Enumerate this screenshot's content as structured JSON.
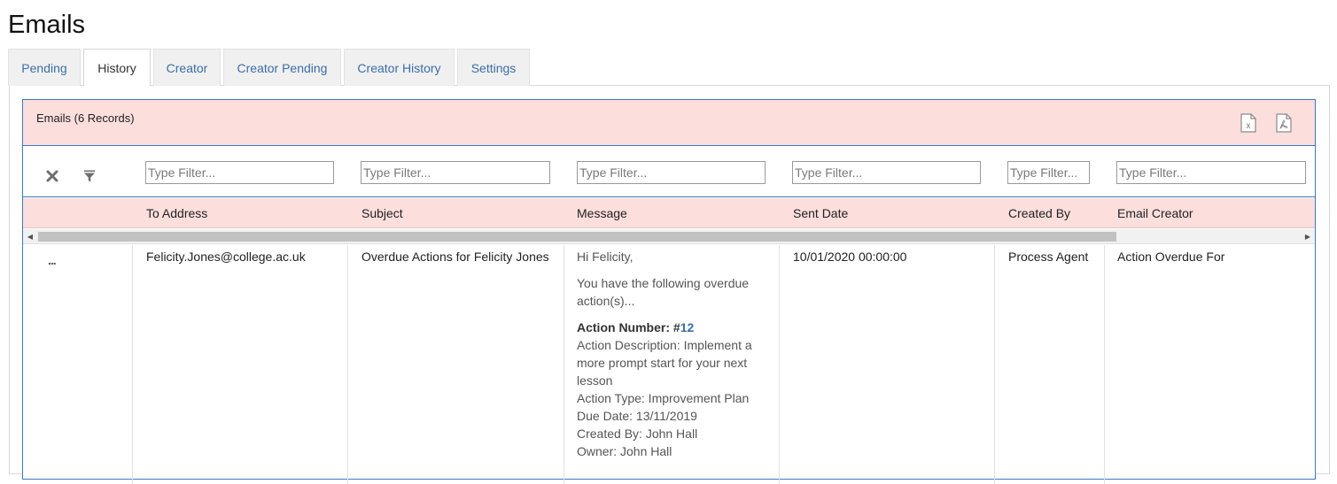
{
  "page": {
    "title": "Emails"
  },
  "tabs": [
    {
      "label": "Pending"
    },
    {
      "label": "History"
    },
    {
      "label": "Creator"
    },
    {
      "label": "Creator Pending"
    },
    {
      "label": "Creator History"
    },
    {
      "label": "Settings"
    }
  ],
  "active_tab": "History",
  "grid": {
    "title": "Emails (6 Records)",
    "export": {
      "excel_icon": "excel-export-icon",
      "pdf_icon": "pdf-export-icon"
    },
    "filter_placeholder": "Type Filter...",
    "columns": [
      {
        "label": "To Address"
      },
      {
        "label": "Subject"
      },
      {
        "label": "Message"
      },
      {
        "label": "Sent Date"
      },
      {
        "label": "Created By"
      },
      {
        "label": "Email Creator"
      }
    ],
    "rows": [
      {
        "menu": "...",
        "to_address": "Felicity.Jones@college.ac.uk",
        "subject": "Overdue Actions for Felicity Jones",
        "message": {
          "greeting": "Hi Felicity,",
          "intro_1": "You have the following overdue",
          "intro_2": "action(s)...",
          "number_label": "Action Number: #",
          "number_value": "12",
          "desc_1": "Action Description: Implement a",
          "desc_2": "more prompt start for your next",
          "desc_3": "lesson",
          "type": "Action Type: Improvement Plan",
          "due": "Due Date: 13/11/2019",
          "created_by": "Created By: John Hall",
          "owner": "Owner: John Hall"
        },
        "sent_date": "10/01/2020 00:00:00",
        "created_by": "Process Agent",
        "email_creator": "Action Overdue For"
      }
    ]
  },
  "colors": {
    "header_bg": "#fcdedc",
    "border_accent": "#3f78c1",
    "tab_link": "#3a6ea8",
    "link": "#3a6ea8"
  }
}
